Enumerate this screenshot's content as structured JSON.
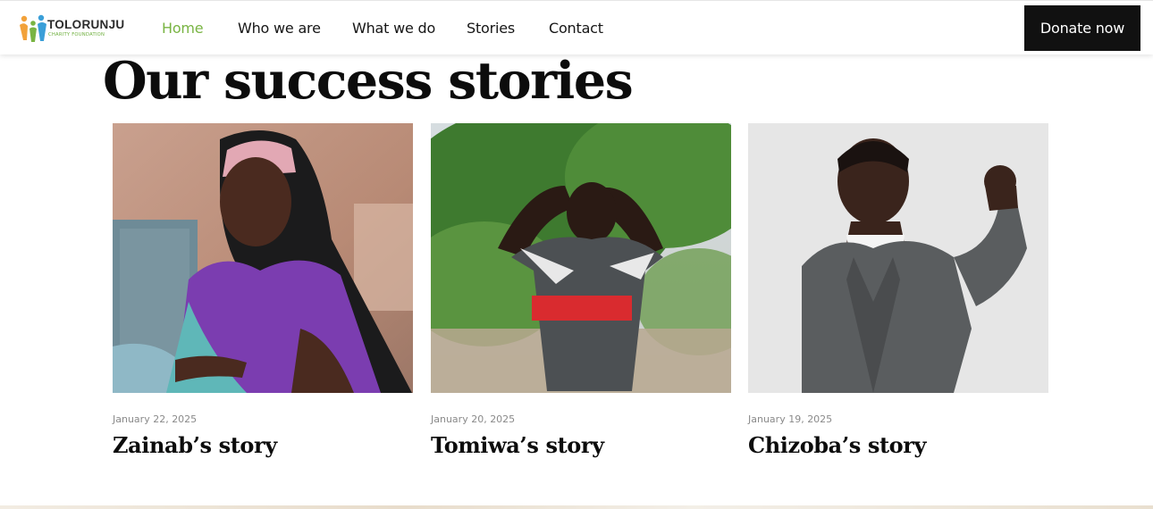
{
  "brand": {
    "name": "TOLORUNJU",
    "tagline": "CHARITY FOUNDATION",
    "colors": {
      "green": "#79b443",
      "orange": "#f2a23a",
      "blue": "#3a9fd8",
      "dark": "#111111"
    }
  },
  "nav": {
    "items": [
      {
        "label": "Home",
        "active": true
      },
      {
        "label": "Who we are",
        "active": false
      },
      {
        "label": "What we do",
        "active": false
      },
      {
        "label": "Stories",
        "active": false
      },
      {
        "label": "Contact",
        "active": false
      }
    ],
    "cta_label": "Donate now"
  },
  "page": {
    "title": "Our success stories"
  },
  "stories": [
    {
      "date": "January 22, 2025",
      "title": "Zainab’s story",
      "image": "girl-in-purple-dress-and-black-headscarf"
    },
    {
      "date": "January 20, 2025",
      "title": "Tomiwa’s story",
      "image": "boy-with-hands-on-head-in-striped-shirt"
    },
    {
      "date": "January 19, 2025",
      "title": "Chizoba’s story",
      "image": "boy-in-grey-cardigan-flexing-arm"
    }
  ]
}
